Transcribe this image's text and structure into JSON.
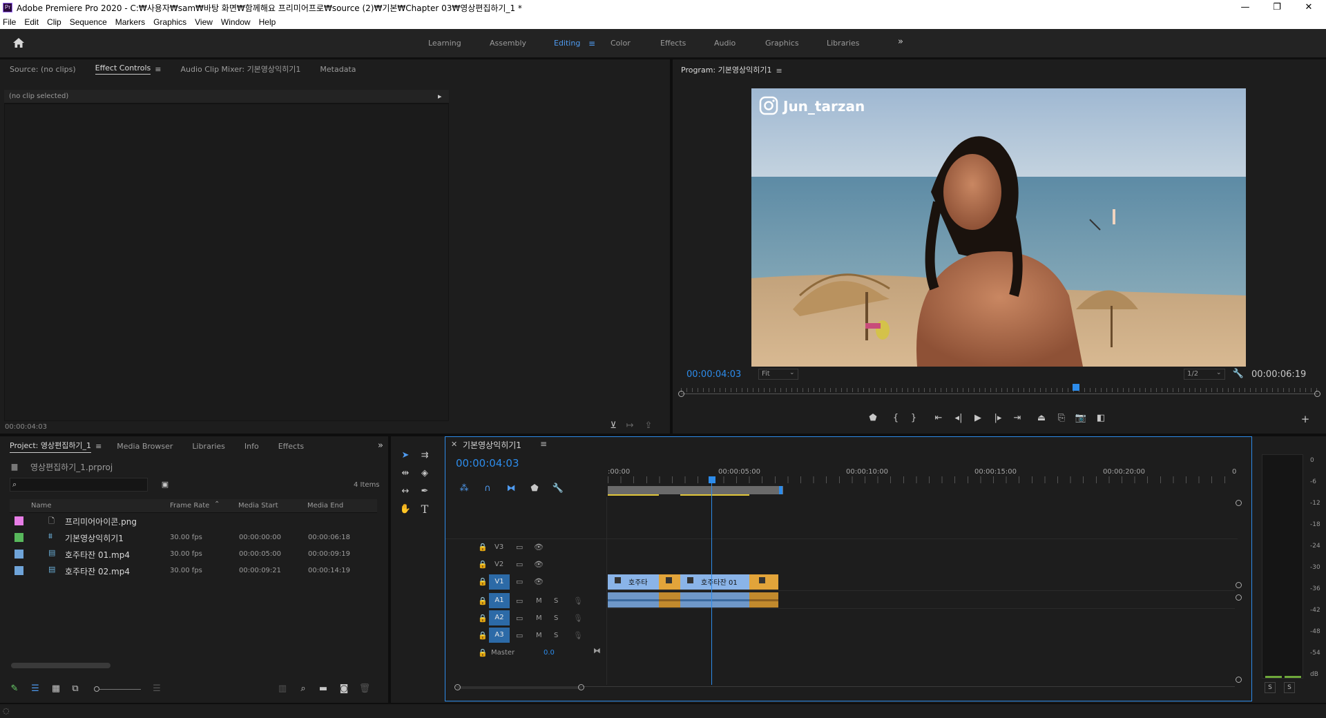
{
  "window": {
    "title": "Adobe Premiere Pro 2020 - C:₩사용자₩sam₩바탕 화면₩함께해요 프리미어프로₩source (2)₩기본₩Chapter 03₩영상편집하기_1 *",
    "app_icon": "Pr"
  },
  "menu": [
    "File",
    "Edit",
    "Clip",
    "Sequence",
    "Markers",
    "Graphics",
    "View",
    "Window",
    "Help"
  ],
  "workspaces": [
    "Learning",
    "Assembly",
    "Editing",
    "Color",
    "Effects",
    "Audio",
    "Graphics",
    "Libraries"
  ],
  "active_workspace": "Editing",
  "source_panel": {
    "tabs": [
      "Source: (no clips)",
      "Effect Controls",
      "Audio Clip Mixer: 기본영상익히기1",
      "Metadata"
    ],
    "active_tab": "Effect Controls",
    "status": "(no clip selected)",
    "timecode": "00:00:04:03"
  },
  "program_monitor": {
    "title": "Program: 기본영상익히기1",
    "overlay_text": "Jun_tarzan",
    "current_time": "00:00:04:03",
    "fit": "Fit",
    "resolution": "1/2",
    "duration": "00:00:06:19",
    "playhead_fraction": 0.62
  },
  "project_panel": {
    "tabs": [
      "Project: 영상편집하기_1",
      "Media Browser",
      "Libraries",
      "Info",
      "Effects"
    ],
    "file": "영상편집하기_1.prproj",
    "item_count": "4 Items",
    "columns": [
      "Name",
      "Frame Rate",
      "Media Start",
      "Media End"
    ],
    "items": [
      {
        "color": "#e77de6",
        "icon": "image",
        "name": "프리미어아이콘.png",
        "rate": "",
        "start": "",
        "end": ""
      },
      {
        "color": "#58b85c",
        "icon": "sequence",
        "name": "기본영상익히기1",
        "rate": "30.00 fps",
        "start": "00:00:00:00",
        "end": "00:00:06:18"
      },
      {
        "color": "#6fa4d9",
        "icon": "video",
        "name": "호주타잔 01.mp4",
        "rate": "30.00 fps",
        "start": "00:00:05:00",
        "end": "00:00:09:19"
      },
      {
        "color": "#6fa4d9",
        "icon": "video",
        "name": "호주타잔 02.mp4",
        "rate": "30.00 fps",
        "start": "00:00:09:21",
        "end": "00:00:14:19"
      }
    ]
  },
  "timeline": {
    "title": "기본영상익히기1",
    "timecode": "00:00:04:03",
    "ruler": [
      ":00:00",
      "00:00:05:00",
      "00:00:10:00",
      "00:00:15:00",
      "00:00:20:00",
      "0"
    ],
    "video_tracks": [
      "V3",
      "V2",
      "V1"
    ],
    "audio_tracks": [
      "A1",
      "A2",
      "A3"
    ],
    "master_label": "Master",
    "master_value": "0.0",
    "track_m": "M",
    "track_s": "S",
    "clips": [
      {
        "label": "호주타",
        "ext": ""
      },
      {
        "label": "",
        "ext": ""
      },
      {
        "label": "호주타잔 01",
        "ext": ""
      },
      {
        "label": "",
        "ext": ""
      }
    ]
  },
  "meter": {
    "labels": [
      "0",
      "-6",
      "-12",
      "-18",
      "-24",
      "-30",
      "-36",
      "-42",
      "-48",
      "-54",
      "dB"
    ],
    "solo": [
      "S",
      "S"
    ]
  },
  "colors": {
    "accent": "#2d8ceb",
    "clip_video": "#8ab4e8",
    "clip_orange": "#e2a43a",
    "track_blue": "#2c6aa7"
  }
}
